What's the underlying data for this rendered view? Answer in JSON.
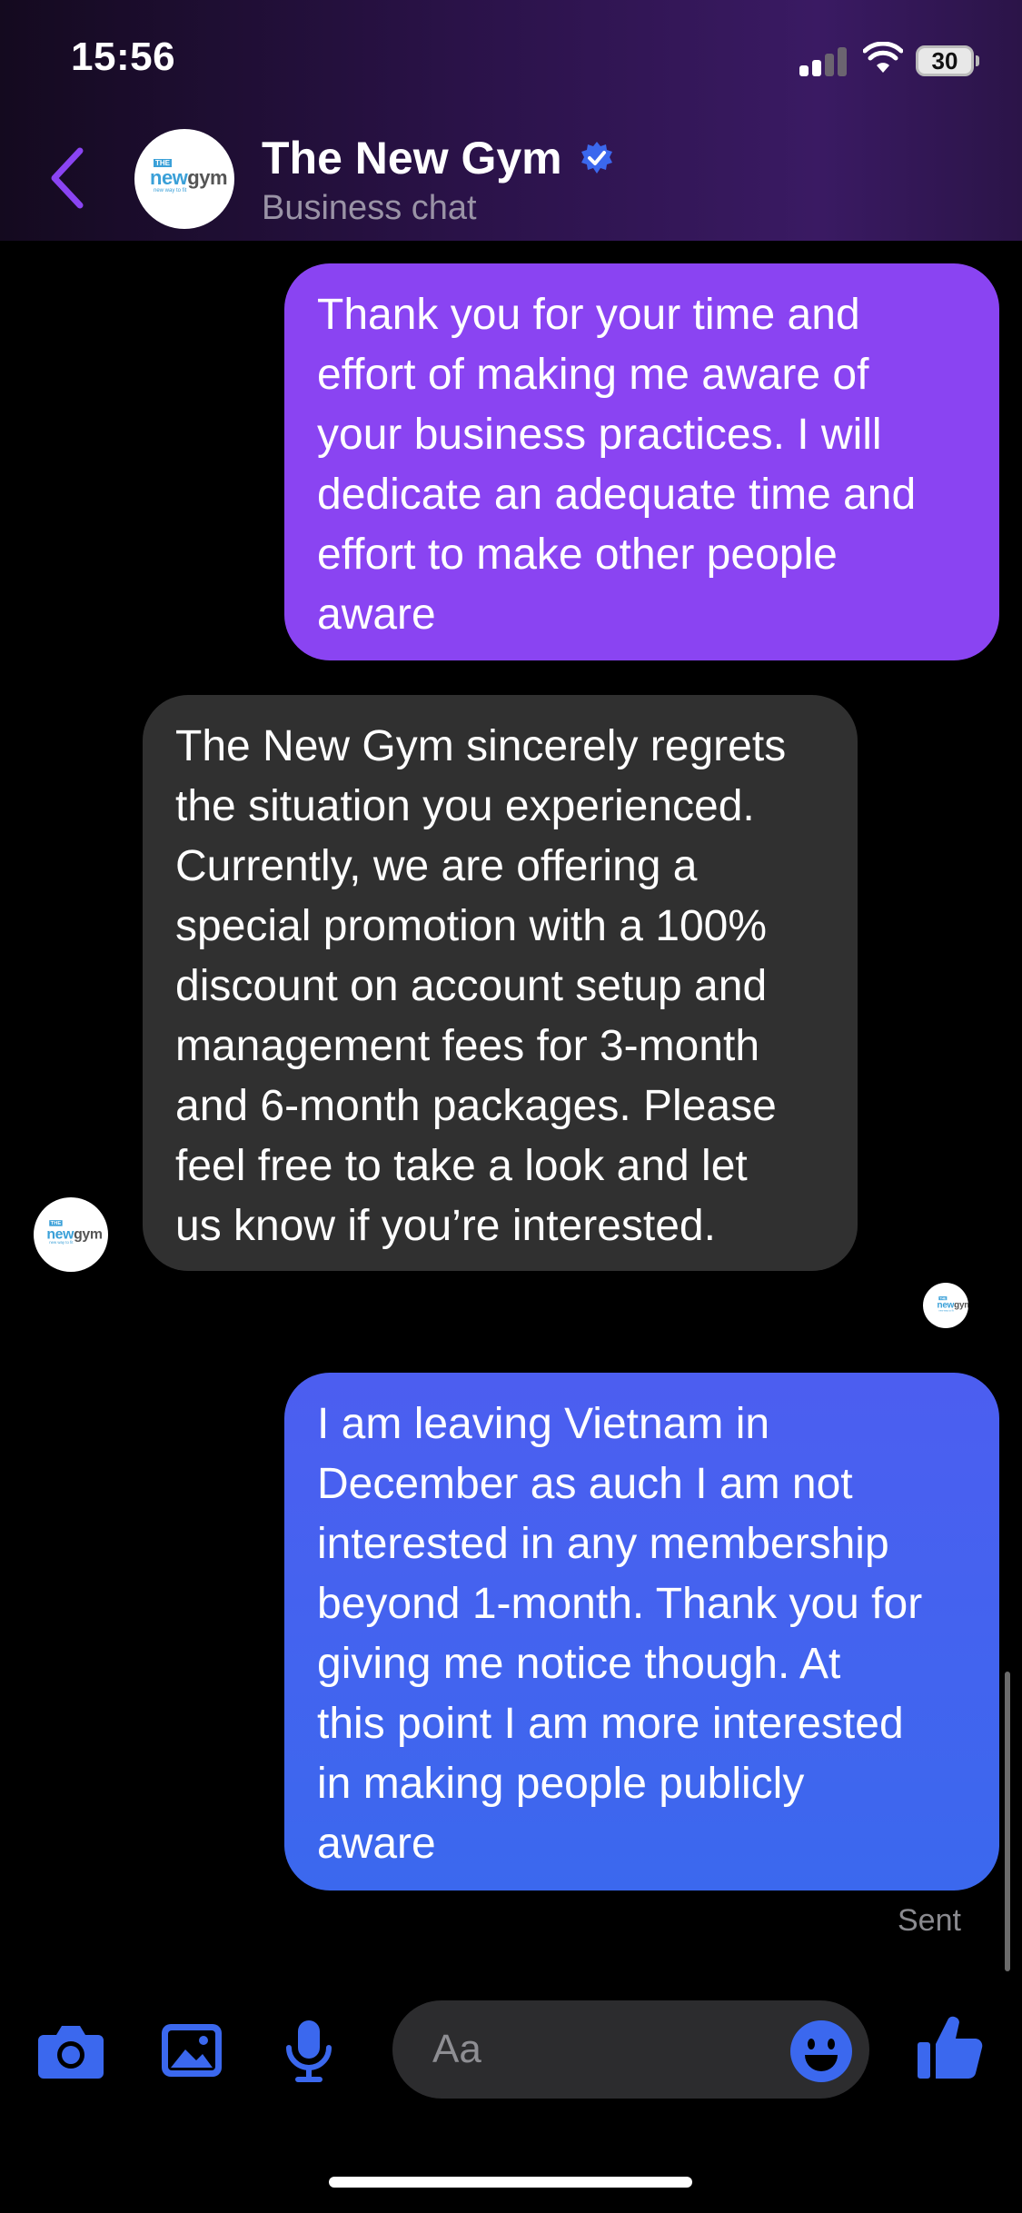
{
  "status_bar": {
    "time": "15:56",
    "battery": "30"
  },
  "header": {
    "title": "The New Gym",
    "subtitle": "Business chat",
    "logo_text": {
      "the": "THE",
      "new": "new",
      "gym": "gym",
      "tag": "new way to fit"
    }
  },
  "messages": [
    {
      "sender": "me",
      "text": "Thank you for your time and\neffort of making me aware of\nyour business practices. I will\ndedicate an adequate time and\neffort to make other people\naware"
    },
    {
      "sender": "business",
      "text": "The New Gym sincerely regrets\nthe situation you experienced.\nCurrently, we are offering a\nspecial promotion with a 100%\ndiscount on account setup and\nmanagement fees for 3-month\nand 6-month packages. Please\nfeel free to take a look and let\nus know if you’re interested."
    },
    {
      "sender": "me",
      "text": "I am leaving Vietnam in\nDecember as auch I am not\ninterested in any membership\nbeyond 1-month. Thank you for\ngiving me notice though. At\nthis point I am more interested\nin making people publicly\naware"
    }
  ],
  "status": {
    "sent": "Sent"
  },
  "composer": {
    "placeholder": "Aa"
  },
  "colors": {
    "accent": "#3b68ee",
    "outgoing_purple": "#8a44f2",
    "incoming": "#303030",
    "back_arrow": "#8a44f2"
  }
}
